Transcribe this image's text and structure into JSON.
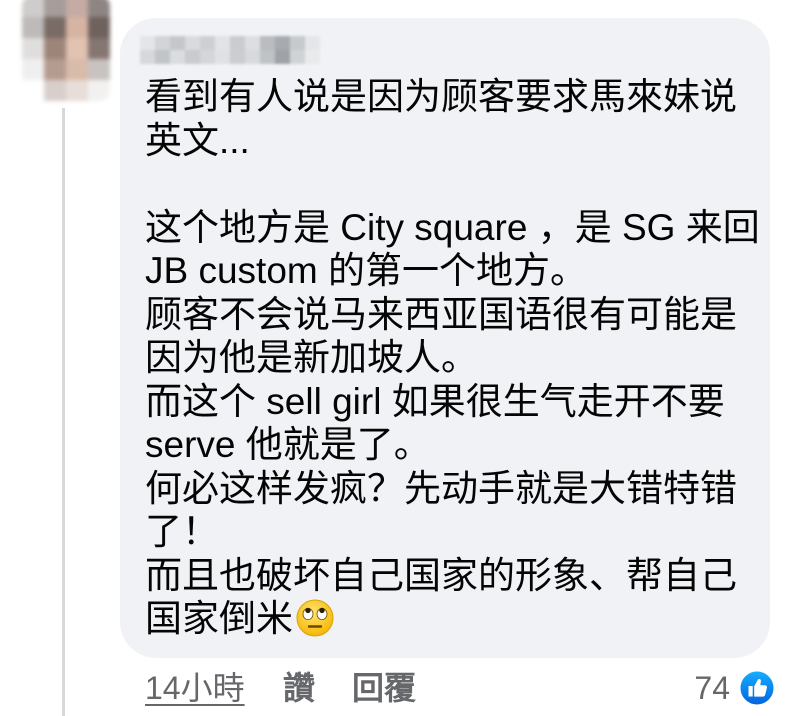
{
  "comment": {
    "lines": [
      "看到有人说是因为顾客要求馬來妹说",
      "英文...",
      "",
      "这个地方是 City square ，是 SG 来回",
      "JB custom 的第一个地方。",
      "顾客不会说马来西亚国语很有可能是",
      "因为他是新加坡人。",
      "而这个 sell girl 如果很生气走开不要",
      "serve 他就是了。",
      "何必这样发疯？先动手就是大错特错",
      "了！",
      "而且也破坏自己国家的形象、帮自己",
      "国家倒米"
    ],
    "trailing_emoji": "face-with-rolling-eyes"
  },
  "actions": {
    "timestamp": "14小時",
    "like_label": "讚",
    "reply_label": "回覆"
  },
  "reactions": {
    "count": "74",
    "icon": "like-thumbs-up"
  },
  "author": {
    "avatar": "blurred-avatar",
    "name": "blurred-name"
  },
  "colors": {
    "bubble": "#f0f2f5",
    "text": "#050505",
    "secondary_text": "#65676b",
    "like_blue": "#1877f2",
    "thread_line": "#d6d8dc"
  }
}
